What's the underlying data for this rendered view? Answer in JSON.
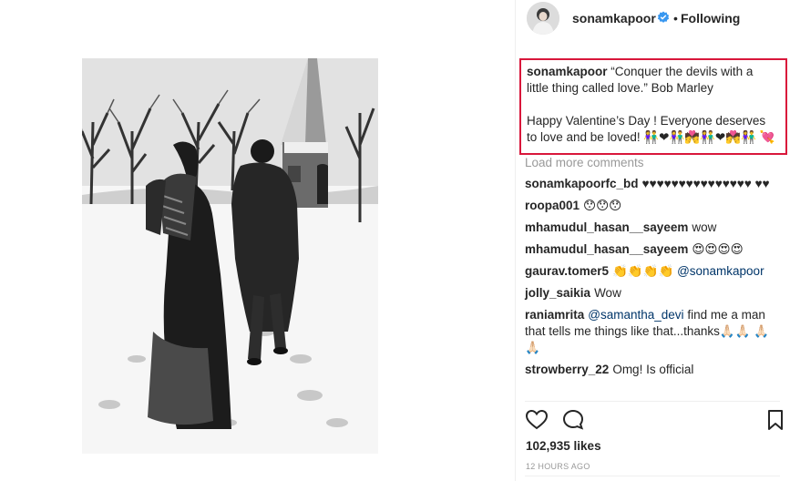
{
  "post": {
    "username": "sonamkapoor",
    "separator": "•",
    "follow_status": "Following"
  },
  "caption": {
    "username": "sonamkapoor",
    "line1": "“Conquer the devils with a",
    "line2": "little thing called love.” Bob Marley",
    "line3": "Happy Valentine’s Day ! Everyone deserves",
    "line4": "to love and be loved! 👫❤👫💏👫❤💏👫 💘"
  },
  "comments": {
    "load_more": "Load more comments",
    "items": [
      {
        "user": "sonamkapoorfc_bd",
        "text": "♥♥♥♥♥♥♥♥♥♥♥♥♥♥♥ ♥♥"
      },
      {
        "user": "roopa001",
        "text": "😯😯😯"
      },
      {
        "user": "mhamudul_hasan__sayeem",
        "text": "wow"
      },
      {
        "user": "mhamudul_hasan__sayeem",
        "text": "😍😍😍😍"
      },
      {
        "user": "gaurav.tomer5",
        "text": "👏👏👏👏",
        "mention": "@sonamkapoor"
      },
      {
        "user": "jolly_saikia",
        "text": "Wow"
      },
      {
        "user": "raniamrita",
        "mention": "@samantha_devi",
        "text": "find me a man that tells me things like that...thanks🙏🏻🙏🏻 🙏🏻🙏🏻"
      },
      {
        "user": "strowberry_22",
        "text": "Omg! Is official"
      }
    ]
  },
  "stats": {
    "likes": "102,935 likes",
    "time": "12 HOURS AGO"
  },
  "icons": {
    "like": "heart-icon",
    "comment": "comment-icon",
    "save": "bookmark-icon",
    "verified": "verified-badge-icon"
  },
  "colors": {
    "highlight_border": "#d9173b",
    "verified_blue": "#3897f0",
    "mention": "#003569"
  }
}
